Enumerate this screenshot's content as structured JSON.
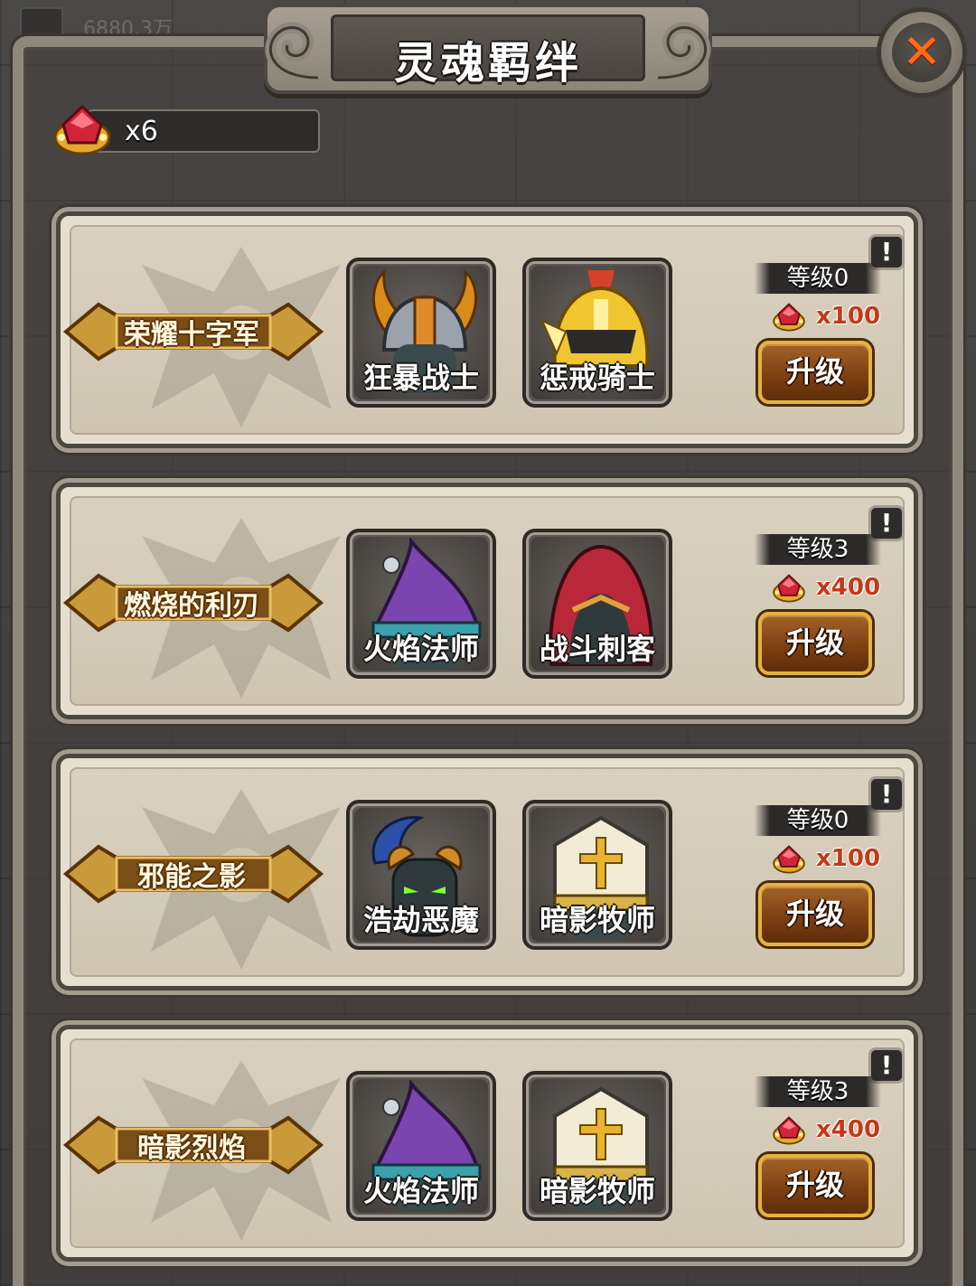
{
  "title": "灵魂羁绊",
  "top_ghost_text": "6880.3万",
  "gem_count": "x6",
  "colors": {
    "accent_gold": "#e4b340",
    "gem_red": "#d0243a",
    "cost_red": "#c23a1a",
    "close_orange": "#ff6a1a"
  },
  "bonds": [
    {
      "name": "荣耀十字军",
      "heroes": [
        {
          "name": "狂暴战士",
          "icon": "viking-helmet"
        },
        {
          "name": "惩戒骑士",
          "icon": "golden-knight-helmet"
        }
      ],
      "level": "等级0",
      "cost": "x100",
      "upgrade_label": "升级",
      "info_label": "!"
    },
    {
      "name": "燃烧的利刃",
      "heroes": [
        {
          "name": "火焰法师",
          "icon": "purple-wizard-hat"
        },
        {
          "name": "战斗刺客",
          "icon": "red-hood"
        }
      ],
      "level": "等级3",
      "cost": "x400",
      "upgrade_label": "升级",
      "info_label": "!"
    },
    {
      "name": "邪能之影",
      "heroes": [
        {
          "name": "浩劫恶魔",
          "icon": "horned-demon"
        },
        {
          "name": "暗影牧师",
          "icon": "priest-mitre"
        }
      ],
      "level": "等级0",
      "cost": "x100",
      "upgrade_label": "升级",
      "info_label": "!"
    },
    {
      "name": "暗影烈焰",
      "heroes": [
        {
          "name": "火焰法师",
          "icon": "purple-wizard-hat"
        },
        {
          "name": "暗影牧师",
          "icon": "priest-mitre"
        }
      ],
      "level": "等级3",
      "cost": "x400",
      "upgrade_label": "升级",
      "info_label": "!"
    }
  ]
}
